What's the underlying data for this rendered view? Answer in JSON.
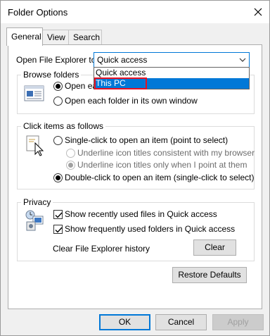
{
  "window": {
    "title": "Folder Options"
  },
  "tabs": [
    {
      "label": "General",
      "active": true
    },
    {
      "label": "View",
      "active": false
    },
    {
      "label": "Search",
      "active": false
    }
  ],
  "open_explorer": {
    "label": "Open File Explorer to:",
    "value": "Quick access",
    "options": [
      "Quick access",
      "This PC"
    ],
    "highlighted": "This PC"
  },
  "browse_folders": {
    "title": "Browse folders",
    "option1": "Open each folder in the same window",
    "option2": "Open each folder in its own window"
  },
  "click_items": {
    "title": "Click items as follows",
    "single_click": "Single-click to open an item (point to select)",
    "underline_consistent": "Underline icon titles consistent with my browser",
    "underline_point": "Underline icon titles only when I point at them",
    "double_click": "Double-click to open an item (single-click to select)"
  },
  "privacy": {
    "title": "Privacy",
    "recent_files": "Show recently used files in Quick access",
    "frequent_folders": "Show frequently used folders in Quick access",
    "clear_history_label": "Clear File Explorer history",
    "clear_button": "Clear"
  },
  "buttons": {
    "restore_defaults": "Restore Defaults",
    "ok": "OK",
    "cancel": "Cancel",
    "apply": "Apply"
  },
  "colors": {
    "accent": "#0078d7",
    "highlight_border": "#e81123"
  }
}
